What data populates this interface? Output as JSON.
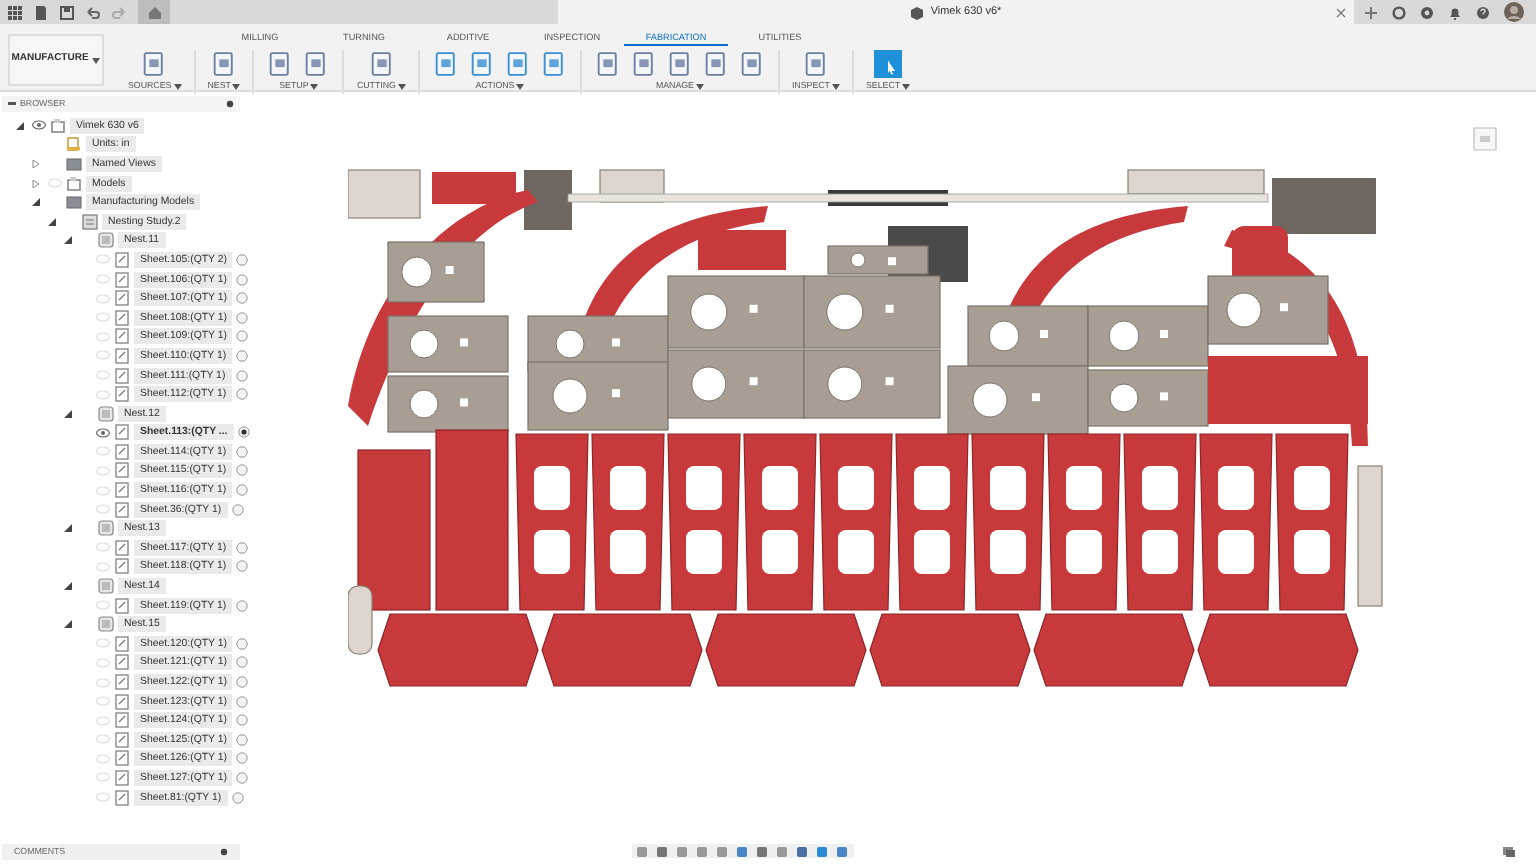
{
  "document_tab": {
    "title": "Vimek 630 v6*"
  },
  "workspace": {
    "label": "MANUFACTURE"
  },
  "tabs": [
    {
      "label": "MILLING",
      "selected": false
    },
    {
      "label": "TURNING",
      "selected": false
    },
    {
      "label": "ADDITIVE",
      "selected": false
    },
    {
      "label": "INSPECTION",
      "selected": false
    },
    {
      "label": "FABRICATION",
      "selected": true
    },
    {
      "label": "UTILITIES",
      "selected": false
    }
  ],
  "groups": [
    {
      "label": "SOURCES"
    },
    {
      "label": "NEST"
    },
    {
      "label": "SETUP"
    },
    {
      "label": "CUTTING"
    },
    {
      "label": "ACTIONS"
    },
    {
      "label": "MANAGE"
    },
    {
      "label": "INSPECT"
    },
    {
      "label": "SELECT"
    }
  ],
  "browser": {
    "title": "BROWSER",
    "tree": [
      {
        "label": "Vimek 630 v6",
        "kind": "component",
        "expanded": true,
        "visible": true,
        "children": [
          {
            "label": "Units: in",
            "kind": "units"
          },
          {
            "label": "Named Views",
            "kind": "folder",
            "expanded": false
          },
          {
            "label": "Models",
            "kind": "component",
            "expanded": false,
            "visible": false
          },
          {
            "label": "Manufacturing Models",
            "kind": "folder",
            "expanded": true,
            "children": [
              {
                "label": "Nesting Study.2",
                "kind": "study",
                "expanded": true,
                "children": [
                  {
                    "label": "Nest.11",
                    "kind": "nest",
                    "expanded": true,
                    "children": [
                      {
                        "label": "Sheet.105:(QTY 2)",
                        "kind": "sheet",
                        "visible": false,
                        "active": false
                      },
                      {
                        "label": "Sheet.106:(QTY 1)",
                        "kind": "sheet",
                        "visible": false,
                        "active": false
                      },
                      {
                        "label": "Sheet.107:(QTY 1)",
                        "kind": "sheet",
                        "visible": false,
                        "active": false
                      },
                      {
                        "label": "Sheet.108:(QTY 1)",
                        "kind": "sheet",
                        "visible": false,
                        "active": false
                      },
                      {
                        "label": "Sheet.109:(QTY 1)",
                        "kind": "sheet",
                        "visible": false,
                        "active": false
                      },
                      {
                        "label": "Sheet.110:(QTY 1)",
                        "kind": "sheet",
                        "visible": false,
                        "active": false
                      },
                      {
                        "label": "Sheet.111:(QTY 1)",
                        "kind": "sheet",
                        "visible": false,
                        "active": false
                      },
                      {
                        "label": "Sheet.112:(QTY 1)",
                        "kind": "sheet",
                        "visible": false,
                        "active": false
                      }
                    ]
                  },
                  {
                    "label": "Nest.12",
                    "kind": "nest",
                    "expanded": true,
                    "children": [
                      {
                        "label": "Sheet.113:(QTY ...",
                        "kind": "sheet",
                        "visible": true,
                        "active": true
                      },
                      {
                        "label": "Sheet.114:(QTY 1)",
                        "kind": "sheet",
                        "visible": false,
                        "active": false
                      },
                      {
                        "label": "Sheet.115:(QTY 1)",
                        "kind": "sheet",
                        "visible": false,
                        "active": false
                      },
                      {
                        "label": "Sheet.116:(QTY 1)",
                        "kind": "sheet",
                        "visible": false,
                        "active": false
                      },
                      {
                        "label": "Sheet.36:(QTY 1)",
                        "kind": "sheet",
                        "visible": false,
                        "active": false
                      }
                    ]
                  },
                  {
                    "label": "Nest.13",
                    "kind": "nest",
                    "expanded": true,
                    "children": [
                      {
                        "label": "Sheet.117:(QTY 1)",
                        "kind": "sheet",
                        "visible": false,
                        "active": false
                      },
                      {
                        "label": "Sheet.118:(QTY 1)",
                        "kind": "sheet",
                        "visible": false,
                        "active": false
                      }
                    ]
                  },
                  {
                    "label": "Nest.14",
                    "kind": "nest",
                    "expanded": true,
                    "children": [
                      {
                        "label": "Sheet.119:(QTY 1)",
                        "kind": "sheet",
                        "visible": false,
                        "active": false
                      }
                    ]
                  },
                  {
                    "label": "Nest.15",
                    "kind": "nest",
                    "expanded": true,
                    "children": [
                      {
                        "label": "Sheet.120:(QTY 1)",
                        "kind": "sheet",
                        "visible": false,
                        "active": false
                      },
                      {
                        "label": "Sheet.121:(QTY 1)",
                        "kind": "sheet",
                        "visible": false,
                        "active": false
                      },
                      {
                        "label": "Sheet.122:(QTY 1)",
                        "kind": "sheet",
                        "visible": false,
                        "active": false
                      },
                      {
                        "label": "Sheet.123:(QTY 1)",
                        "kind": "sheet",
                        "visible": false,
                        "active": false
                      },
                      {
                        "label": "Sheet.124:(QTY 1)",
                        "kind": "sheet",
                        "visible": false,
                        "active": false
                      },
                      {
                        "label": "Sheet.125:(QTY 1)",
                        "kind": "sheet",
                        "visible": false,
                        "active": false
                      },
                      {
                        "label": "Sheet.126:(QTY 1)",
                        "kind": "sheet",
                        "visible": false,
                        "active": false
                      },
                      {
                        "label": "Sheet.127:(QTY 1)",
                        "kind": "sheet",
                        "visible": false,
                        "active": false
                      },
                      {
                        "label": "Sheet.81:(QTY 1)",
                        "kind": "sheet",
                        "visible": false,
                        "active": false
                      }
                    ]
                  }
                ]
              }
            ]
          }
        ]
      }
    ]
  },
  "comments": {
    "title": "COMMENTS"
  }
}
